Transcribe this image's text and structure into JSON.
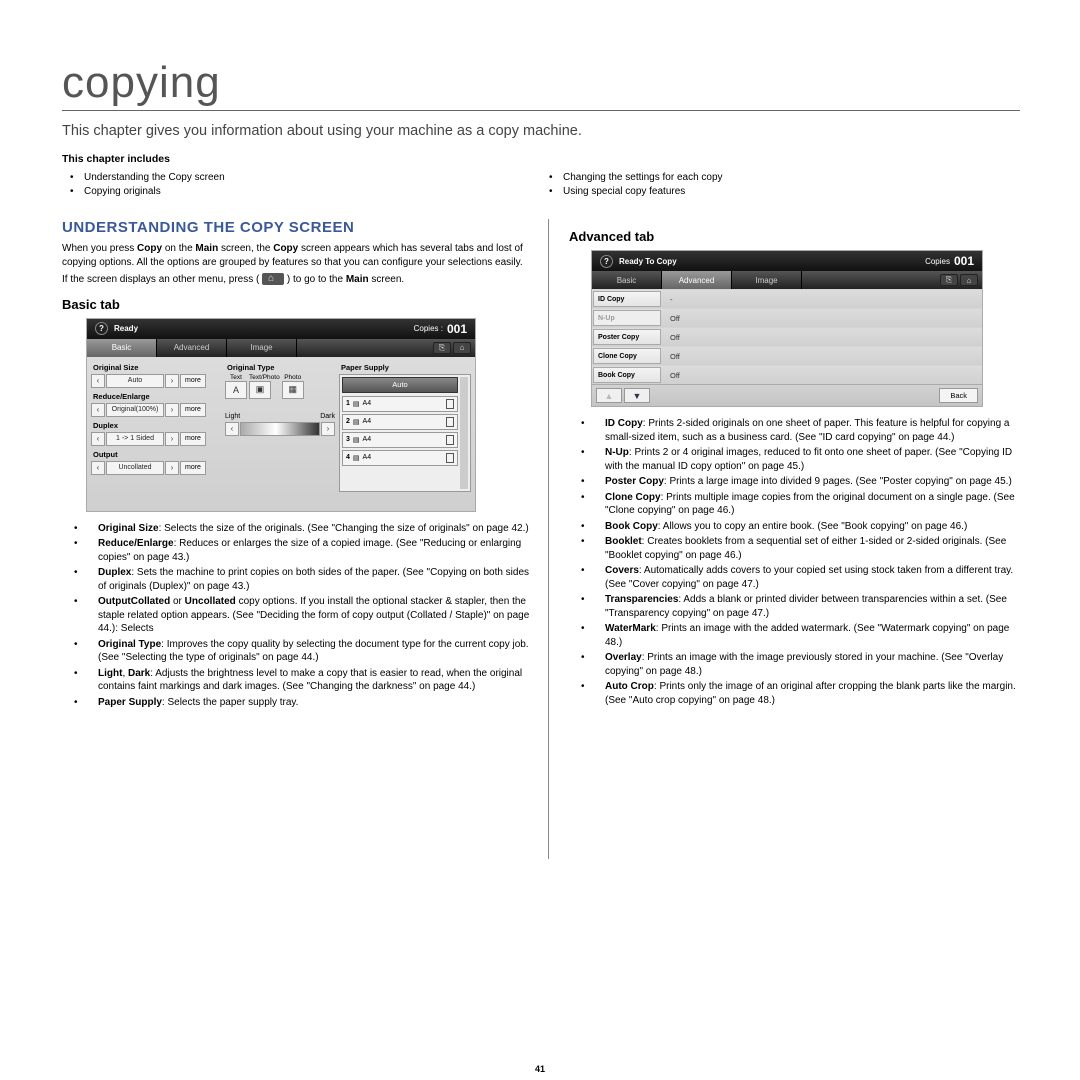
{
  "chapter": {
    "title": "copying",
    "intro": "This chapter gives you information about using your machine as a copy machine.",
    "includes_heading": "This chapter includes",
    "includes_left": [
      "Understanding the Copy screen",
      "Copying originals"
    ],
    "includes_right": [
      "Changing the settings for each copy",
      "Using special copy features"
    ]
  },
  "section1": {
    "heading": "UNDERSTANDING THE COPY SCREEN",
    "p1a": "When you press ",
    "p1b": "Copy",
    "p1c": " on the ",
    "p1d": "Main",
    "p1e": " screen, the ",
    "p1f": "Copy",
    "p1g": " screen appears which has several tabs and lost of copying options. All the options are grouped by features so that you can configure your selections easily.",
    "p2a": "If the screen displays an other menu, press ( ",
    "p2b": " ) to go to the ",
    "p2c": "Main",
    "p2d": " screen."
  },
  "basic": {
    "heading": "Basic tab",
    "ss": {
      "status": "Ready",
      "copies_label": "Copies :",
      "copies_value": "001",
      "tabs": [
        "Basic",
        "Advanced",
        "Image"
      ],
      "groups": {
        "original_size": {
          "label": "Original Size",
          "value": "Auto",
          "more": "more"
        },
        "reduce_enlarge": {
          "label": "Reduce/Enlarge",
          "value": "Original(100%)",
          "more": "more"
        },
        "duplex": {
          "label": "Duplex",
          "value": "1 -> 1 Sided",
          "more": "more"
        },
        "output": {
          "label": "Output",
          "value": "Uncollated",
          "more": "more"
        },
        "original_type": {
          "label": "Original Type",
          "opts": [
            "Text",
            "Text/Photo",
            "Photo"
          ]
        },
        "dark": {
          "left": "Light",
          "right": "Dark"
        },
        "paper_supply": {
          "label": "Paper Supply",
          "auto": "Auto",
          "trays": [
            {
              "n": "1",
              "orient": "▤",
              "size": "A4",
              "p": "▯"
            },
            {
              "n": "2",
              "orient": "▤",
              "size": "A4",
              "p": "▯"
            },
            {
              "n": "3",
              "orient": "▤",
              "size": "A4",
              "p": "▯"
            },
            {
              "n": "4",
              "orient": "▤",
              "size": "A4",
              "p": "▯"
            }
          ]
        }
      }
    },
    "bullets": [
      {
        "b": "Original Size",
        "t": ": Selects the size of the originals. (See \"Changing the size of originals\" on page 42.)"
      },
      {
        "b": "Reduce/Enlarge",
        "t": ": Reduces or enlarges the size of a copied image. (See \"Reducing or enlarging copies\" on page 43.)"
      },
      {
        "b": "Duplex",
        "t": ": Sets the machine to print copies on both sides of the paper. (See \"Copying on both sides of originals (Duplex)\" on page 43.)"
      },
      {
        "b": "Output",
        "t": ": Selects ",
        "b2": "Collated",
        "t2": " or ",
        "b3": "Uncollated",
        "t3": " copy options. If you install the optional stacker & stapler, then the staple related option appears. (See \"Deciding the form of copy output (Collated / Staple)\" on page 44.)"
      },
      {
        "b": "Original Type",
        "t": ": Improves the copy quality by selecting the document type for the current copy job. (See \"Selecting the type of originals\" on page 44.)"
      },
      {
        "b": "Light",
        "mid": ", ",
        "b2": "Dark",
        "t": ": Adjusts the brightness level to make a copy that is easier to read, when the original contains faint markings and dark images. (See \"Changing the darkness\" on page 44.)"
      },
      {
        "b": "Paper Supply",
        "t": ": Selects the paper supply tray."
      }
    ]
  },
  "advanced": {
    "heading": "Advanced tab",
    "ss": {
      "status": "Ready To Copy",
      "copies_label": "Copies",
      "copies_value": "001",
      "tabs": [
        "Basic",
        "Advanced",
        "Image"
      ],
      "rows": [
        {
          "label": "ID Copy",
          "value": "-"
        },
        {
          "label": "N-Up",
          "value": "Off",
          "disabled": true
        },
        {
          "label": "Poster Copy",
          "value": "Off"
        },
        {
          "label": "Clone Copy",
          "value": "Off"
        },
        {
          "label": "Book Copy",
          "value": "Off"
        }
      ],
      "back": "Back"
    },
    "bullets": [
      {
        "b": "ID Copy",
        "t": ": Prints 2-sided originals on one sheet of paper. This feature is helpful for copying a small-sized item, such as a business card. (See \"ID card copying\" on page 44.)"
      },
      {
        "b": "N-Up",
        "t": ": Prints 2 or 4 original images, reduced to fit onto one sheet of paper. (See \"Copying ID with the manual ID copy option\" on page 45.)"
      },
      {
        "b": "Poster Copy",
        "t": ": Prints a large image into divided 9 pages. (See \"Poster copying\" on page 45.)"
      },
      {
        "b": "Clone Copy",
        "t": ": Prints multiple image copies from the original document on a single page. (See \"Clone copying\" on page 46.)"
      },
      {
        "b": "Book Copy",
        "t": ": Allows you to copy an entire book. (See \"Book copying\" on page 46.)"
      },
      {
        "b": "Booklet",
        "t": ": Creates booklets from a sequential set of either 1-sided or 2-sided originals. (See \"Booklet copying\" on page 46.)"
      },
      {
        "b": "Covers",
        "t": ": Automatically adds covers to your copied set using stock taken from a different tray. (See \"Cover copying\" on page 47.)"
      },
      {
        "b": "Transparencies",
        "t": ": Adds a blank or printed divider between transparencies within a set. (See \"Transparency copying\" on page 47.)"
      },
      {
        "b": "WaterMark",
        "t": ": Prints an image with the added watermark. (See \"Watermark copying\" on page 48.)"
      },
      {
        "b": "Overlay",
        "t": ": Prints an image with the image previously stored in your machine. (See \"Overlay copying\" on page 48.)"
      },
      {
        "b": "Auto Crop",
        "t": ": Prints only the image of an original after cropping the blank parts like the margin. (See \"Auto crop copying\" on page 48.)"
      }
    ]
  },
  "page_number": "41"
}
